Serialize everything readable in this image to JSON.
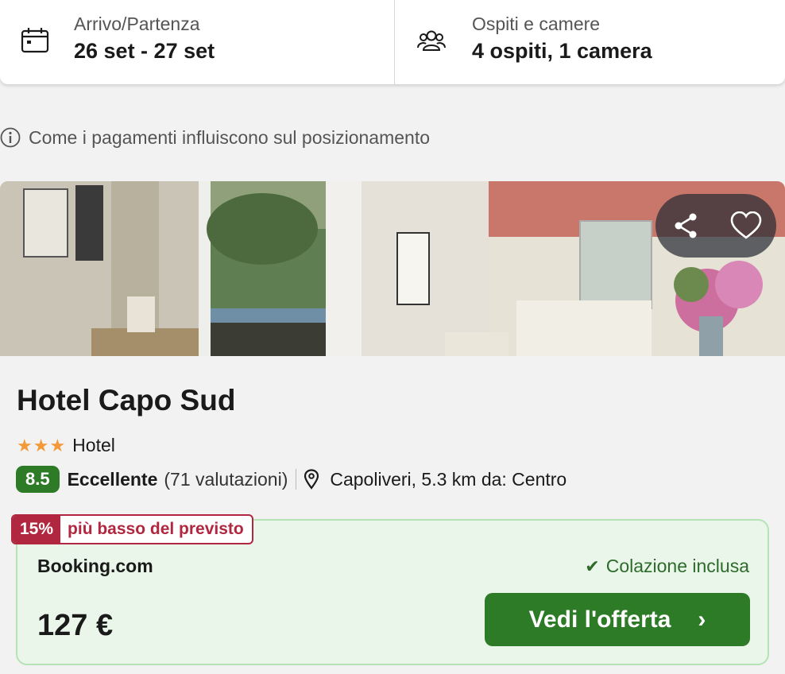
{
  "search": {
    "dates_label": "Arrivo/Partenza",
    "dates_value": "26 set - 27 set",
    "guests_label": "Ospiti e camere",
    "guests_value": "4 ospiti, 1 camera"
  },
  "payment_info": "Come i pagamenti influiscono sul posizionamento",
  "photo": {
    "actions": [
      "share-icon",
      "heart-icon"
    ]
  },
  "hotel": {
    "name": "Hotel Capo Sud",
    "stars": "★★★",
    "type": "Hotel",
    "score": "8.5",
    "rating_text": "Eccellente",
    "reviews": "(71 valutazioni)",
    "location": "Capoliveri, 5.3 km da: Centro"
  },
  "deal": {
    "discount_pct": "15%",
    "discount_text": "più basso del previsto",
    "provider": "Booking.com",
    "breakfast_check": "✔",
    "breakfast": "Colazione inclusa",
    "price": "127 €",
    "cta": "Vedi l'offerta",
    "cta_chevron": "›"
  },
  "colors": {
    "green": "#2d7a27",
    "discount": "#b0273f",
    "star": "#f29a38",
    "deal_bg": "#e9f6e9"
  }
}
